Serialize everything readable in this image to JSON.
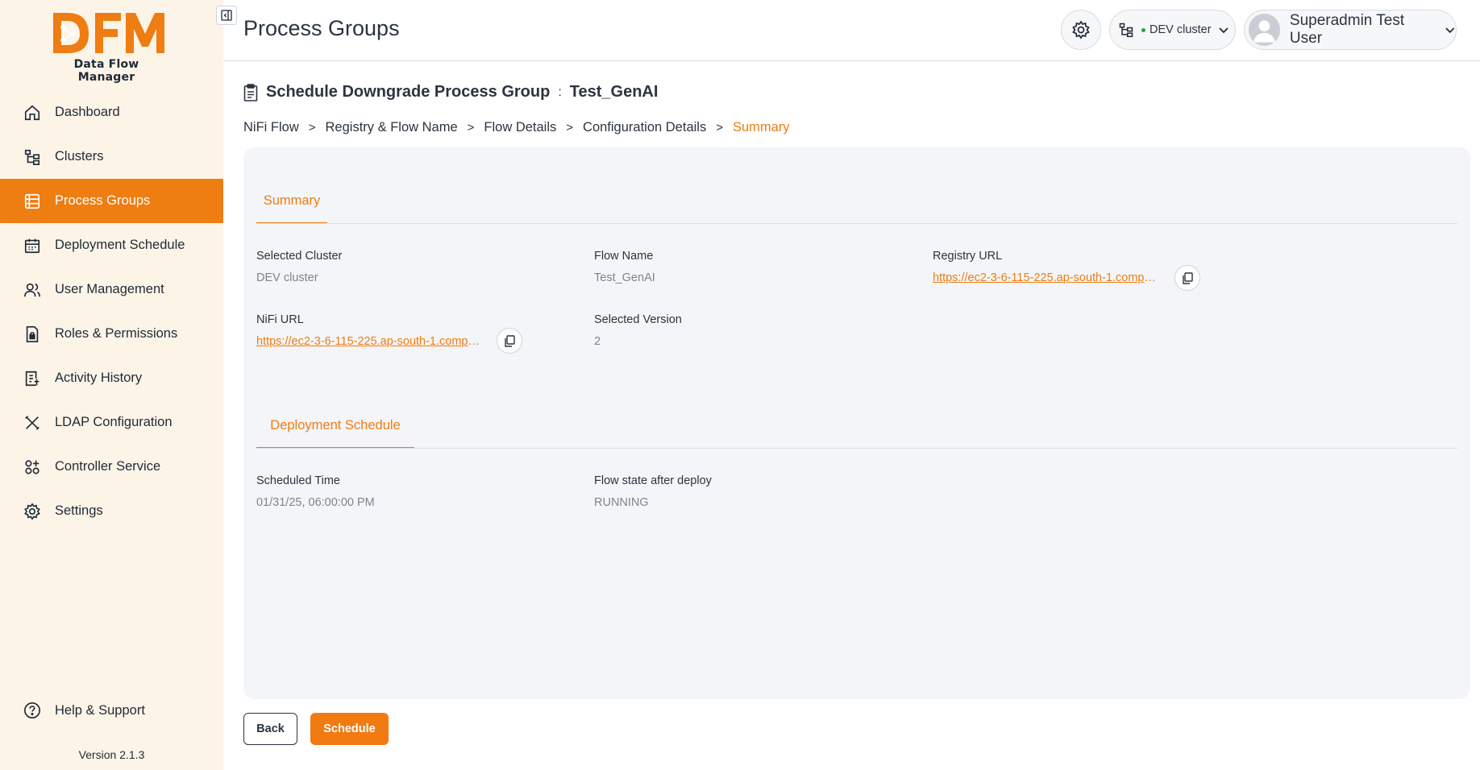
{
  "brand": {
    "logo_text": "DFM",
    "subtitle": "Data Flow Manager",
    "accent": "#ee7d12"
  },
  "sidebar": {
    "items": [
      {
        "label": "Dashboard",
        "icon": "home-icon"
      },
      {
        "label": "Clusters",
        "icon": "cluster-tree-icon"
      },
      {
        "label": "Process Groups",
        "icon": "process-groups-icon",
        "active": true
      },
      {
        "label": "Deployment Schedule",
        "icon": "calendar-icon"
      },
      {
        "label": "User Management",
        "icon": "users-icon"
      },
      {
        "label": "Roles & Permissions",
        "icon": "lock-document-icon"
      },
      {
        "label": "Activity History",
        "icon": "activity-list-icon"
      },
      {
        "label": "LDAP Configuration",
        "icon": "tools-icon"
      },
      {
        "label": "Controller Service",
        "icon": "controller-service-icon"
      },
      {
        "label": "Settings",
        "icon": "gear-icon"
      }
    ],
    "help_label": "Help & Support",
    "version": "Version 2.1.3"
  },
  "header": {
    "title": "Process Groups",
    "cluster_label": "DEV cluster",
    "user_name": "Superadmin Test User"
  },
  "content": {
    "title": "Schedule Downgrade Process Group",
    "separator": ":",
    "process_group_name": "Test_GenAI",
    "breadcrumb": [
      "NiFi Flow",
      "Registry & Flow Name",
      "Flow Details",
      "Configuration Details",
      "Summary"
    ]
  },
  "summary": {
    "tab_label": "Summary",
    "selected_cluster_label": "Selected Cluster",
    "selected_cluster_value": "DEV cluster",
    "flow_name_label": "Flow Name",
    "flow_name_value": "Test_GenAI",
    "registry_url_label": "Registry URL",
    "registry_url_value": "https://ec2-3-6-115-225.ap-south-1.comput...",
    "nifi_url_label": "NiFi URL",
    "nifi_url_value": "https://ec2-3-6-115-225.ap-south-1.comput...",
    "selected_version_label": "Selected Version",
    "selected_version_value": "2"
  },
  "deployment": {
    "tab_label": "Deployment Schedule",
    "scheduled_time_label": "Scheduled Time",
    "scheduled_time_value": "01/31/25, 06:00:00 PM",
    "flow_state_label": "Flow state after deploy",
    "flow_state_value": "RUNNING"
  },
  "actions": {
    "back_label": "Back",
    "schedule_label": "Schedule"
  }
}
